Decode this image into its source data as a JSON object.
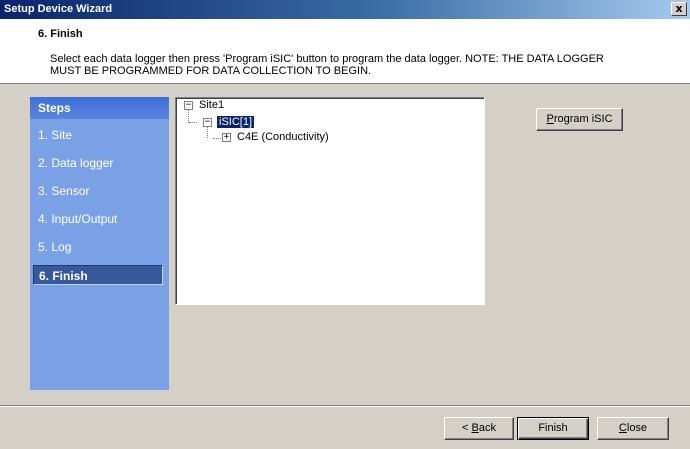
{
  "window": {
    "title": "Setup Device Wizard",
    "close_glyph": "x"
  },
  "header": {
    "title": "6. Finish",
    "desc_line1": "Select each data logger then press 'Program iSIC' button to program the data logger.  NOTE: THE DATA LOGGER",
    "desc_line2": "MUST BE PROGRAMMED FOR DATA COLLECTION TO BEGIN."
  },
  "steps": {
    "heading": "Steps",
    "items": [
      {
        "label": "1. Site",
        "active": false
      },
      {
        "label": "2. Data logger",
        "active": false
      },
      {
        "label": "3. Sensor",
        "active": false
      },
      {
        "label": "4. Input/Output",
        "active": false
      },
      {
        "label": "5. Log",
        "active": false
      },
      {
        "label": "6. Finish",
        "active": true
      }
    ]
  },
  "tree": {
    "root": {
      "label": "Site1",
      "expanded": true,
      "expander": "−"
    },
    "logger": {
      "label": "iSIC[1]",
      "selected": true,
      "expander": "−"
    },
    "sensor": {
      "label": "C4E (Conductivity)",
      "expander": "+"
    }
  },
  "buttons": {
    "program": {
      "prefix": "",
      "accel": "P",
      "rest": "rogram iSIC"
    },
    "back": {
      "prefix": "< ",
      "accel": "B",
      "rest": "ack"
    },
    "finish": {
      "prefix": "",
      "accel": "",
      "rest": "Finish"
    },
    "close": {
      "prefix": "",
      "accel": "C",
      "rest": "lose"
    }
  }
}
